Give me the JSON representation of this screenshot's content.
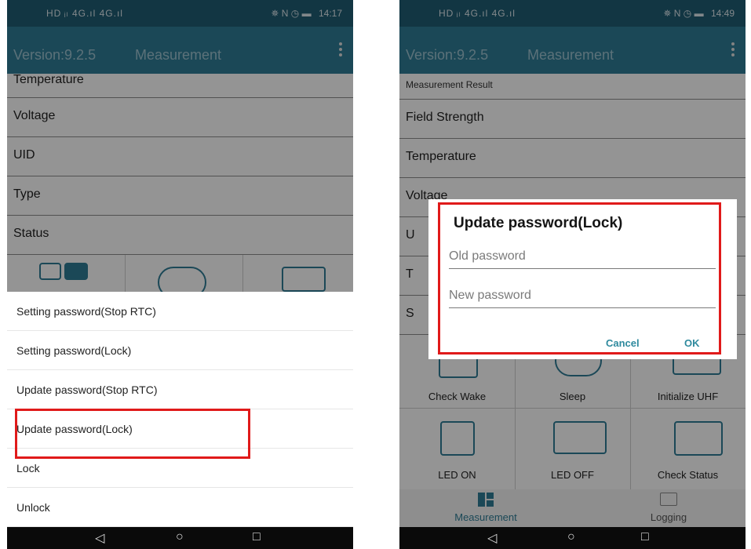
{
  "left": {
    "statusbar": {
      "left": "HD ᵢₗ 4G.ıl 4G.ıl",
      "time": "14:17",
      "icons": "✵ N ◷ ▬"
    },
    "appbar": {
      "version": "Version:9.2.5",
      "title": "Measurement"
    },
    "rows": [
      "Temperature",
      "Voltage",
      "UID",
      "Type",
      "Status"
    ],
    "menu_items": [
      "Setting password(Stop RTC)",
      "Setting password(Lock)",
      "Update password(Stop RTC)",
      "Update password(Lock)",
      "Lock",
      "Unlock"
    ],
    "navbar": {
      "back": "◁",
      "home": "○",
      "recent": "□"
    }
  },
  "right": {
    "statusbar": {
      "left": "HD ᵢₗ 4G.ıl 4G.ıl",
      "time": "14:49",
      "icons": "✵ N ◷ ▬"
    },
    "appbar": {
      "version": "Version:9.2.5",
      "title": "Measurement"
    },
    "section_header": "Measurement Result",
    "rows": [
      "Field Strength",
      "Temperature",
      "Voltage",
      "U",
      "T",
      "S"
    ],
    "grid": [
      {
        "label": "Check Wake"
      },
      {
        "label": "Sleep"
      },
      {
        "label": "Initialize UHF"
      },
      {
        "label": "LED ON"
      },
      {
        "label": "LED OFF"
      },
      {
        "label": "Check Status"
      }
    ],
    "bottom_nav": [
      {
        "label": "Measurement"
      },
      {
        "label": "Logging"
      }
    ],
    "dialog": {
      "title": "Update password(Lock)",
      "old_placeholder": "Old password",
      "new_placeholder": "New password",
      "cancel": "Cancel",
      "ok": "OK"
    },
    "navbar": {
      "back": "◁",
      "home": "○",
      "recent": "□"
    }
  }
}
